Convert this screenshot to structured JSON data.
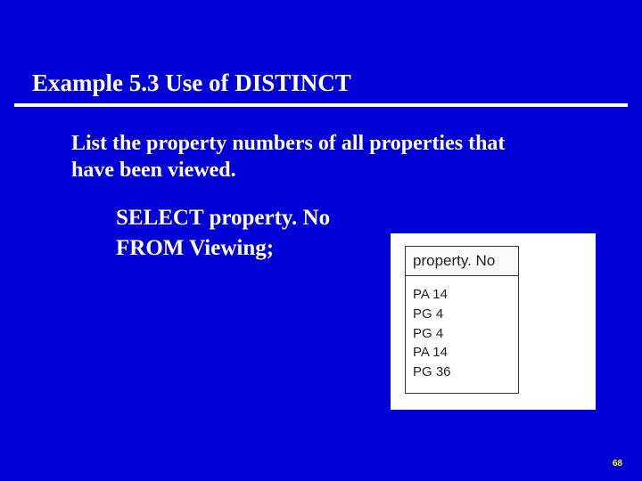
{
  "title": "Example 5.3  Use of DISTINCT",
  "body": "List the property numbers of all properties that have been viewed.",
  "sql": {
    "line1": "SELECT property. No",
    "line2": "FROM Viewing;"
  },
  "result": {
    "header": "property. No",
    "rows": [
      "PA 14",
      "PG 4",
      "PG 4",
      "PA 14",
      "PG 36"
    ]
  },
  "pageNumber": "68",
  "chart_data": {
    "type": "table",
    "title": "property. No",
    "columns": [
      "property. No"
    ],
    "rows": [
      [
        "PA 14"
      ],
      [
        "PG 4"
      ],
      [
        "PG 4"
      ],
      [
        "PA 14"
      ],
      [
        "PG 36"
      ]
    ]
  }
}
